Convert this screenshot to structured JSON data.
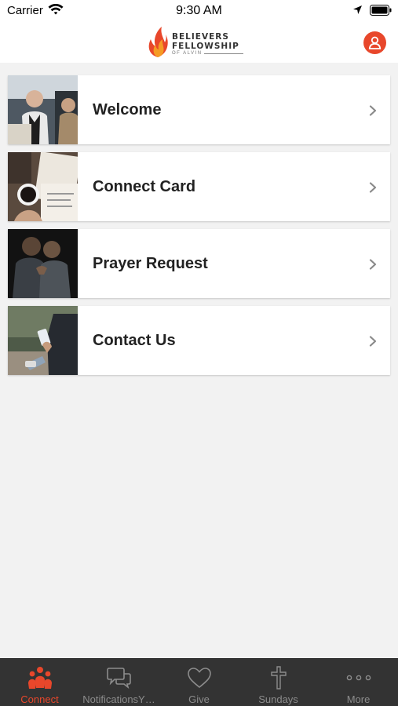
{
  "status_bar": {
    "carrier": "Carrier",
    "time": "9:30 AM",
    "icons": [
      "wifi-icon",
      "location-arrow-icon",
      "battery-icon"
    ]
  },
  "header": {
    "logo_line1": "BELIEVERS",
    "logo_line2": "FELLOWSHIP",
    "logo_line3": "OF ALVIN",
    "profile_icon": "user-icon",
    "accent_color": "#e8472b"
  },
  "menu": {
    "items": [
      {
        "label": "Welcome",
        "image": "people-greeting-photo"
      },
      {
        "label": "Connect Card",
        "image": "coffee-notebook-photo"
      },
      {
        "label": "Prayer Request",
        "image": "people-praying-photo"
      },
      {
        "label": "Contact Us",
        "image": "phone-in-hand-photo"
      }
    ]
  },
  "tab_bar": {
    "active": "Connect",
    "tabs": [
      {
        "label": "Connect",
        "icon": "people-group-icon"
      },
      {
        "label": "NotificationsY…",
        "icon": "chat-bubbles-icon"
      },
      {
        "label": "Give",
        "icon": "heart-icon"
      },
      {
        "label": "Sundays",
        "icon": "cross-icon"
      },
      {
        "label": "More",
        "icon": "more-dots-icon"
      }
    ]
  }
}
